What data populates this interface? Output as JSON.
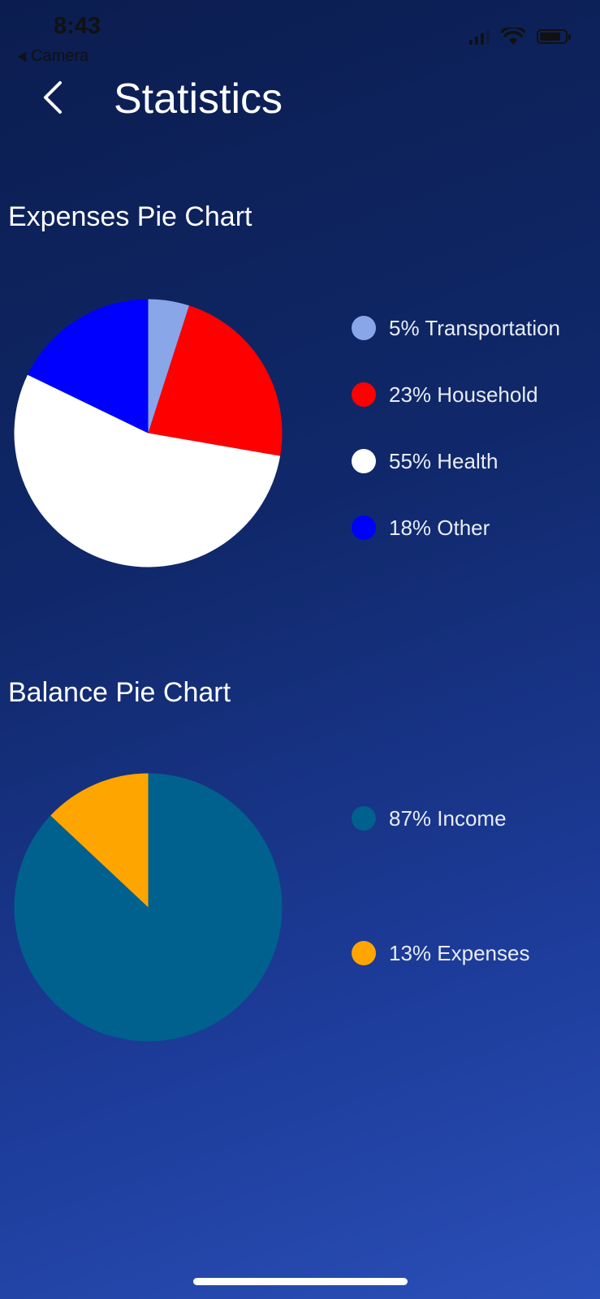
{
  "status_bar": {
    "time": "8:43",
    "back_app": "Camera"
  },
  "header": {
    "title": "Statistics",
    "back_icon": "chevron-left-icon"
  },
  "charts": {
    "expenses": {
      "title": "Expenses Pie Chart",
      "legend": [
        {
          "label": "5% Transportation",
          "color": "#89a6e8"
        },
        {
          "label": "23% Household",
          "color": "#ff0000"
        },
        {
          "label": "55% Health",
          "color": "#ffffff"
        },
        {
          "label": "18% Other",
          "color": "#0000ff"
        }
      ]
    },
    "balance": {
      "title": "Balance Pie Chart",
      "legend": [
        {
          "label": "87% Income",
          "color": "#00618f"
        },
        {
          "label": "13% Expenses",
          "color": "#ffa500"
        }
      ]
    }
  },
  "chart_data": [
    {
      "type": "pie",
      "title": "Expenses Pie Chart",
      "categories": [
        "Transportation",
        "Household",
        "Health",
        "Other"
      ],
      "values": [
        5,
        23,
        55,
        18
      ],
      "colors": [
        "#89a6e8",
        "#ff0000",
        "#ffffff",
        "#0000ff"
      ],
      "legend": "right"
    },
    {
      "type": "pie",
      "title": "Balance Pie Chart",
      "categories": [
        "Income",
        "Expenses"
      ],
      "values": [
        87,
        13
      ],
      "colors": [
        "#00618f",
        "#ffa500"
      ],
      "legend": "right"
    }
  ]
}
